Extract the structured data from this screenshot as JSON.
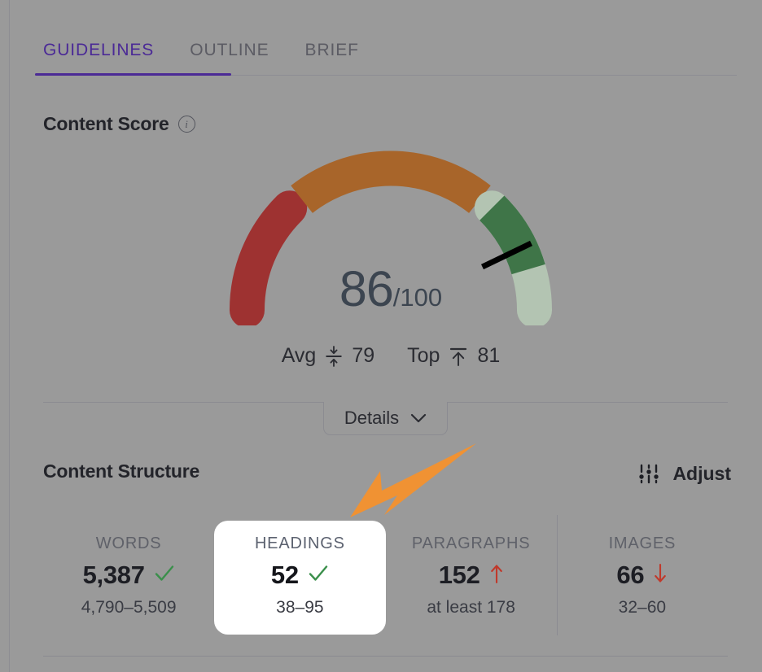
{
  "tabs": [
    {
      "label": "GUIDELINES",
      "active": true
    },
    {
      "label": "OUTLINE",
      "active": false
    },
    {
      "label": "BRIEF",
      "active": false
    }
  ],
  "content_score": {
    "title": "Content Score",
    "info_icon": "info-icon",
    "score": "86",
    "out_of": "/100",
    "score_value": 86,
    "max_value": 100,
    "benchmarks": [
      {
        "label": "Avg",
        "icon": "collapse-vertical-icon",
        "value": "79"
      },
      {
        "label": "Top",
        "icon": "arrow-up-to-line-icon",
        "value": "81"
      }
    ],
    "gauge": {
      "segments": [
        {
          "name": "low",
          "color": "#9e3231",
          "from": 0,
          "to": 33
        },
        {
          "name": "medium",
          "color": "#a8652a",
          "from": 34,
          "to": 66
        },
        {
          "name": "high",
          "color": "#3f7548",
          "from": 67,
          "to": 100
        }
      ],
      "remaining_color": "#b3c4b2",
      "needle_color": "#000000",
      "needle_at": 86
    },
    "details_button": {
      "label": "Details",
      "icon": "chevron-down-icon"
    }
  },
  "content_structure": {
    "title": "Content Structure",
    "adjust_button": {
      "label": "Adjust",
      "icon": "sliders-icon"
    },
    "stats": [
      {
        "caption": "WORDS",
        "value": "5,387",
        "mark": "check",
        "mark_color": "#3a8f4b",
        "range": "4,790–5,509",
        "highlighted": false
      },
      {
        "caption": "HEADINGS",
        "value": "52",
        "mark": "check",
        "mark_color": "#3a8f4b",
        "range": "38–95",
        "highlighted": true
      },
      {
        "caption": "PARAGRAPHS",
        "value": "152",
        "mark": "arrow-up",
        "mark_color": "#c0392b",
        "range": "at least 178",
        "highlighted": false
      },
      {
        "caption": "IMAGES",
        "value": "66",
        "mark": "arrow-down",
        "mark_color": "#c0392b",
        "range": "32–60",
        "highlighted": false
      }
    ]
  },
  "annotation": {
    "arrow_color": "#f09233",
    "points_to": "HEADINGS"
  },
  "colors": {
    "background": "#9a9a9a",
    "accent": "#4b2a96",
    "text_dark": "#23242a",
    "text_muted": "#5f6169",
    "divider": "#8b8b91"
  }
}
